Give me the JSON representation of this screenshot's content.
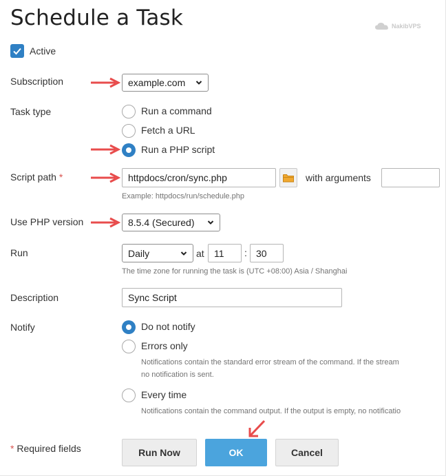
{
  "page": {
    "title": "Schedule a Task"
  },
  "watermark": "NakibVPS",
  "active": {
    "label": "Active",
    "checked": true
  },
  "subscription": {
    "label": "Subscription",
    "value": "example.com"
  },
  "task_type": {
    "label": "Task type",
    "options": [
      "Run a command",
      "Fetch a URL",
      "Run a PHP script"
    ],
    "selected": "Run a PHP script"
  },
  "script_path": {
    "label": "Script path",
    "required_mark": "*",
    "value": "httpdocs/cron/sync.php",
    "with_arguments_label": "with arguments",
    "arguments_value": "",
    "hint": "Example: httpdocs/run/schedule.php"
  },
  "php_version": {
    "label": "Use PHP version",
    "value": "8.5.4 (Secured)"
  },
  "run": {
    "label": "Run",
    "frequency": "Daily",
    "at_label": "at",
    "hour": "11",
    "separator": ":",
    "minute": "30",
    "hint": "The time zone for running the task is (UTC +08:00) Asia / Shanghai"
  },
  "description": {
    "label": "Description",
    "value": "Sync Script"
  },
  "notify": {
    "label": "Notify",
    "options": [
      {
        "label": "Do not notify",
        "hint": ""
      },
      {
        "label": "Errors only",
        "hint_line1": "Notifications contain the standard error stream of the command. If the stream",
        "hint_line2": "no notification is sent."
      },
      {
        "label": "Every time",
        "hint_line1": "Notifications contain the command output. If the output is empty, no notificatio"
      }
    ],
    "selected": "Do not notify"
  },
  "footer": {
    "required_fields": "* Required fields",
    "run_now": "Run Now",
    "ok": "OK",
    "cancel": "Cancel"
  },
  "colors": {
    "accent": "#2f80c4",
    "primary_button": "#4ba4dd",
    "annotation_arrow": "#e84c4c"
  }
}
